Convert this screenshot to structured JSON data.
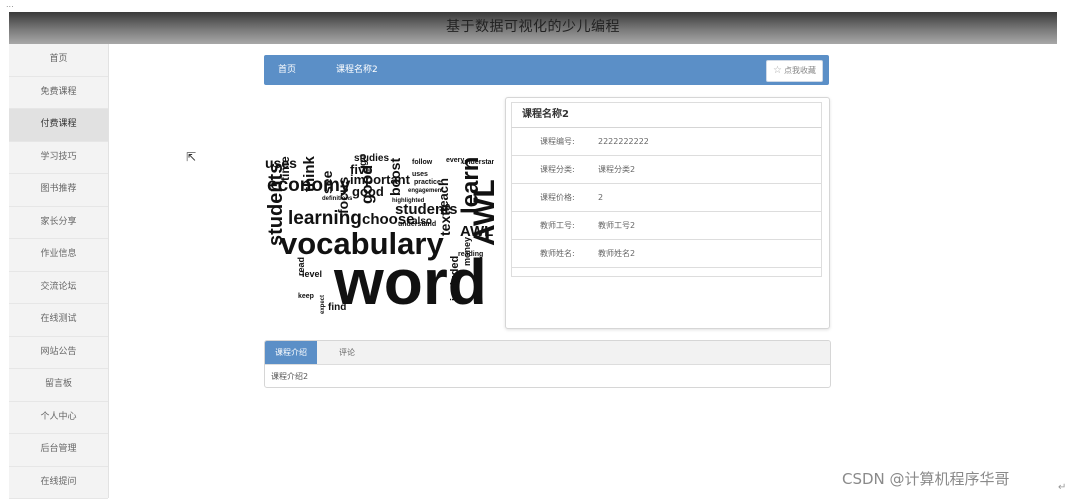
{
  "top_strip_text": "...",
  "header": {
    "title": "基于数据可视化的少儿编程"
  },
  "sidebar": {
    "items": [
      {
        "label": "首页"
      },
      {
        "label": "免费课程"
      },
      {
        "label": "付费课程"
      },
      {
        "label": "学习技巧"
      },
      {
        "label": "图书推荐"
      },
      {
        "label": "家长分享"
      },
      {
        "label": "作业信息"
      },
      {
        "label": "交流论坛"
      },
      {
        "label": "在线测试"
      },
      {
        "label": "网站公告"
      },
      {
        "label": "留言板"
      },
      {
        "label": "个人中心"
      },
      {
        "label": "后台管理"
      },
      {
        "label": "在线提问"
      }
    ],
    "active_index": 2
  },
  "breadcrumb": {
    "home": "首页",
    "current": "课程名称2"
  },
  "favorite_button": {
    "label": "点我收藏"
  },
  "word_cloud": {
    "words": [
      "word",
      "vocabulary",
      "students",
      "learning",
      "economy",
      "choose",
      "focus",
      "important",
      "think",
      "see",
      "five",
      "ones",
      "boost",
      "good",
      "go",
      "learn",
      "AWL",
      "texts",
      "teach",
      "also",
      "used",
      "level",
      "read",
      "find",
      "keep",
      "time",
      "uses",
      "follow",
      "every",
      "understand",
      "connotations",
      "reading",
      "definitions",
      "highlighted",
      "engagement",
      "practice",
      "frequently",
      "studies",
      "expect",
      "included",
      "money",
      "might",
      "school",
      "single",
      "journals",
      "associations",
      "across",
      "quick",
      "compression",
      "list",
      "give",
      "back",
      "sure",
      "Cashed",
      "entry"
    ]
  },
  "course_info": {
    "title": "课程名称2",
    "rows": [
      {
        "label": "课程编号:",
        "value": "2222222222"
      },
      {
        "label": "课程分类:",
        "value": "课程分类2"
      },
      {
        "label": "课程价格:",
        "value": "2"
      },
      {
        "label": "教师工号:",
        "value": "教师工号2"
      },
      {
        "label": "教师姓名:",
        "value": "教师姓名2"
      }
    ]
  },
  "tabs": {
    "items": [
      {
        "label": "课程介绍"
      },
      {
        "label": "评论"
      }
    ],
    "active_index": 0,
    "content": "课程介绍2"
  },
  "watermark": "CSDN @计算机程序华哥",
  "colors": {
    "accent": "#5b8fc7",
    "sidebar_bg": "#f3f3f3",
    "header_dark": "#3a3a3a"
  }
}
